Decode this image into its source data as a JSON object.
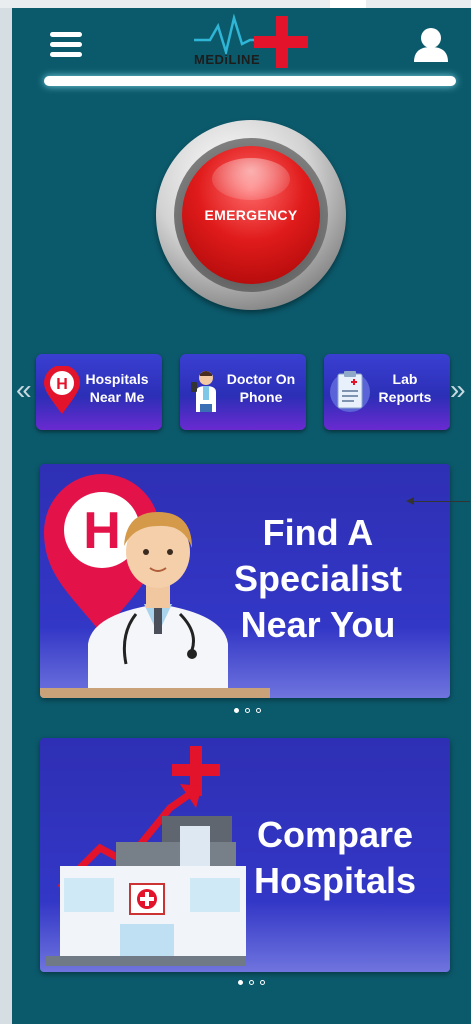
{
  "header": {
    "logo_text": "MEDiLINE",
    "menu_icon": "hamburger-menu-icon",
    "profile_icon": "user-profile-icon"
  },
  "emergency": {
    "label": "EMERGENCY",
    "color": "#e01b1b"
  },
  "quick_links": [
    {
      "label": "Hospitals Near Me",
      "line1": "Hospitals",
      "line2": "Near Me",
      "icon": "hospital-pin-icon"
    },
    {
      "label": "Doctor On Phone",
      "line1": "Doctor On",
      "line2": "Phone",
      "icon": "doctor-phone-icon"
    },
    {
      "label": "Lab Reports",
      "line1": "Lab",
      "line2": "Reports",
      "icon": "lab-report-clipboard-icon"
    }
  ],
  "carousel_arrows": {
    "left": "«",
    "right": "»"
  },
  "banners": [
    {
      "lines": [
        "Find A",
        "Specialist",
        "Near You"
      ],
      "image": "doctor-hospital-pin-illustration",
      "dots": 3,
      "active_dot": 0
    },
    {
      "lines": [
        "Compare",
        "Hospitals"
      ],
      "image": "hospital-growth-chart-illustration",
      "dots": 3,
      "active_dot": 0
    }
  ],
  "colors": {
    "background": "#0b5a6c",
    "tile": "#2b2fb6",
    "banner": "#3337c6",
    "accent_red": "#e3132b"
  }
}
